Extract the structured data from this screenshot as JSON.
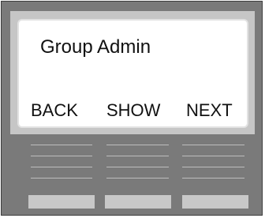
{
  "screen": {
    "title": "Group Admin",
    "softkeys": {
      "back": "BACK",
      "show": "SHOW",
      "next": "NEXT"
    }
  },
  "colors": {
    "body": "#7a7a7a",
    "bezel": "#c6c6c6",
    "display": "#ffffff",
    "grille": "#bdbdbd",
    "keys": "#c8c8c8"
  }
}
